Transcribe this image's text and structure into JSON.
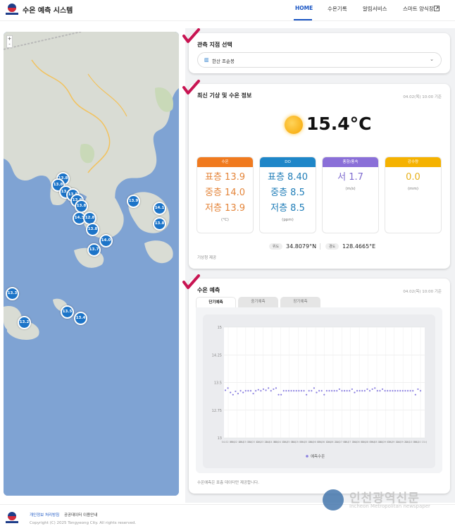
{
  "header": {
    "title": "수온 예측 시스템",
    "nav": [
      {
        "label": "HOME",
        "active": true
      },
      {
        "label": "수온기록",
        "active": false
      },
      {
        "label": "알림서비스",
        "active": false
      },
      {
        "label": "스마트 양식장",
        "active": false
      }
    ],
    "external_icon": "external-link-icon"
  },
  "map": {
    "zoom_in": "+",
    "zoom_out": "-",
    "markers": [
      "13.8",
      "13.8",
      "13.8",
      "13.8",
      "13.8",
      "13.8",
      "14.3",
      "12.8",
      "13.8",
      "13.9",
      "14.1",
      "13.8",
      "14.0",
      "13.7",
      "13.3",
      "13.5",
      "13.4",
      "13.2"
    ]
  },
  "station": {
    "title": "관측 지점 선택",
    "selected": "한산 조순봉",
    "icon": "map-icon"
  },
  "weather": {
    "title": "최신 기상 및 수온 정보",
    "timestamp": "04.02(목) 10:00 기준",
    "temperature": "15.4°C",
    "metrics": [
      {
        "header": "수온",
        "color": "#f07a1f",
        "value_color": "#e4853a",
        "lines": [
          "표층 13.9",
          "중층 14.0",
          "저층 13.9"
        ],
        "unit": "(°C)"
      },
      {
        "header": "DO",
        "color": "#1e86c8",
        "value_color": "#1f7db8",
        "lines": [
          "표층 8.40",
          "중층 8.5",
          "저층 8.5"
        ],
        "unit": "(ppm)"
      },
      {
        "header": "풍향/풍속",
        "color": "#8a6fd8",
        "value_color": "#7e6bcf",
        "lines": [
          "서 1.7"
        ],
        "unit": "(m/s)"
      },
      {
        "header": "강수량",
        "color": "#f5b200",
        "value_color": "#e7b019",
        "lines": [
          "0.0"
        ],
        "unit": "(mm)"
      }
    ],
    "lat_label": "위도",
    "lat": "34.8079°N",
    "lon_label": "경도",
    "lon": "128.4665°E",
    "source": "기상청 제공"
  },
  "forecast": {
    "title": "수온 예측",
    "timestamp": "04.02(목) 10:00 기준",
    "tabs": [
      "단기예측",
      "중기예측",
      "장기예측"
    ],
    "footnote": "수온예측은 표층 데이터만 제공합니다."
  },
  "chart_data": {
    "type": "scatter",
    "ylim": [
      13,
      15
    ],
    "yticks": [
      "15",
      "14.25",
      "13.5",
      "12.75",
      "13"
    ],
    "xticks": [
      "04.02 09시",
      "04.02 18시",
      "04.03 03시",
      "04.03 12시",
      "04.03 21시",
      "04.04 06시",
      "04.04 15시",
      "04.05 00시",
      "04.05 09시",
      "04.05 18시",
      "04.06 03시",
      "04.06 12시",
      "04.06 21시",
      "04.07 06시",
      "04.07 15시",
      "04.08 00시",
      "04.08 09시",
      "04.08 18시",
      "04.09 03시",
      "04.09 12시",
      "04.09 21시",
      "04.10 06시",
      "04.10 15시"
    ],
    "series": [
      {
        "name": "예측수온",
        "color": "#8a7fe0",
        "values": [
          13.86,
          13.9,
          13.82,
          13.78,
          13.84,
          13.8,
          13.85,
          13.82,
          13.85,
          13.85,
          13.85,
          13.8,
          13.85,
          13.87,
          13.85,
          13.88,
          13.86,
          13.9,
          13.85,
          13.88,
          13.9,
          13.78,
          13.78,
          13.85,
          13.85,
          13.85,
          13.85,
          13.85,
          13.85,
          13.85,
          13.85,
          13.85,
          13.78,
          13.85,
          13.85,
          13.9,
          13.82,
          13.85,
          13.85,
          13.78,
          13.85,
          13.85,
          13.85,
          13.85,
          13.85,
          13.88,
          13.85,
          13.85,
          13.85,
          13.85,
          13.88,
          13.82,
          13.85,
          13.85,
          13.85,
          13.85,
          13.88,
          13.85,
          13.88,
          13.9,
          13.85,
          13.85,
          13.88,
          13.85,
          13.85,
          13.85,
          13.85,
          13.85,
          13.85,
          13.85,
          13.85,
          13.85,
          13.85,
          13.85,
          13.85,
          13.78,
          13.88,
          13.85
        ]
      }
    ],
    "legend": "bottom-center",
    "grid": true
  },
  "footer": {
    "privacy": "개인정보 처리방침",
    "public_data": "공공데이터 이용안내",
    "copyright": "Copyright (C) 2025 Tongyeong City. All rights reserved."
  },
  "watermark": {
    "name": "인천광역신문",
    "sub": "Incheon Metropolitan newspaper"
  },
  "colors": {
    "accent": "#1a56c4",
    "marker": "#1c74c8",
    "check": "#c81452"
  }
}
